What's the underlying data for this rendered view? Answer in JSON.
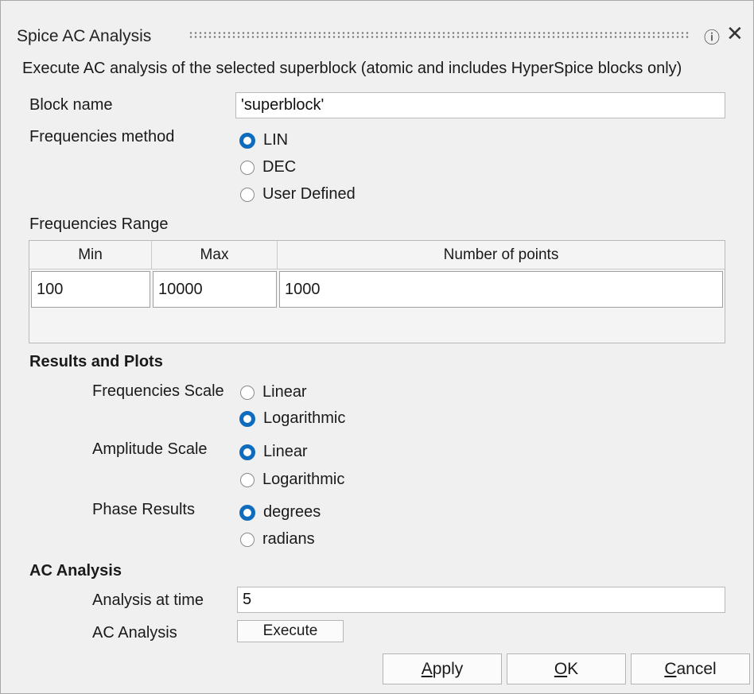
{
  "window": {
    "title": "Spice AC Analysis"
  },
  "description": "Execute AC analysis of the selected superblock (atomic and includes HyperSpice blocks only)",
  "block_name": {
    "label": "Block name",
    "value": "'superblock'"
  },
  "freq_method": {
    "label": "Frequencies method",
    "options": [
      "LIN",
      "DEC",
      "User Defined"
    ],
    "selected": "LIN"
  },
  "freq_range": {
    "label": "Frequencies Range",
    "columns": [
      "Min",
      "Max",
      "Number of points"
    ],
    "row": [
      "100",
      "10000",
      "1000"
    ]
  },
  "results": {
    "heading": "Results and Plots",
    "freq_scale": {
      "label": "Frequencies Scale",
      "options": [
        "Linear",
        "Logarithmic"
      ],
      "selected": "Logarithmic"
    },
    "amp_scale": {
      "label": "Amplitude Scale",
      "options": [
        "Linear",
        "Logarithmic"
      ],
      "selected": "Linear"
    },
    "phase": {
      "label": "Phase Results",
      "options": [
        "degrees",
        "radians"
      ],
      "selected": "degrees"
    }
  },
  "ac": {
    "heading": "AC Analysis",
    "time_label": "Analysis at time",
    "time_value": "5",
    "run_label": "AC Analysis",
    "execute": "Execute"
  },
  "buttons": {
    "apply_prefix": "",
    "apply_key": "A",
    "apply_rest": "pply",
    "ok_prefix": "",
    "ok_key": "O",
    "ok_rest": "K",
    "cancel_prefix": "",
    "cancel_key": "C",
    "cancel_rest": "ancel"
  },
  "colors": {
    "accent": "#0f6cbd"
  },
  "icons": {
    "help": "help-circle-icon",
    "close": "close-icon"
  }
}
